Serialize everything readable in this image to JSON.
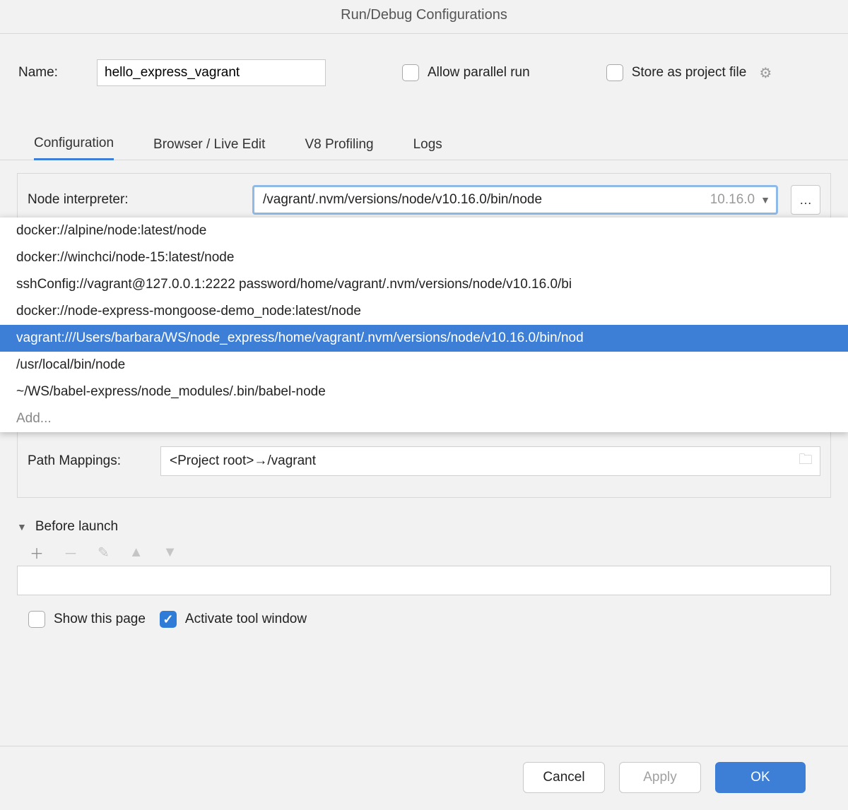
{
  "title": "Run/Debug Configurations",
  "name": {
    "label": "Name:",
    "value": "hello_express_vagrant"
  },
  "allow_parallel": {
    "label": "Allow parallel run",
    "checked": false
  },
  "store_project_file": {
    "label": "Store as project file",
    "checked": false
  },
  "tabs": [
    "Configuration",
    "Browser / Live Edit",
    "V8 Profiling",
    "Logs"
  ],
  "active_tab": 0,
  "node_interpreter": {
    "label": "Node interpreter:",
    "value": "/vagrant/.nvm/versions/node/v10.16.0/bin/node",
    "version": "10.16.0",
    "options": [
      "docker://alpine/node:latest/node",
      "docker://winchci/node-15:latest/node",
      "sshConfig://vagrant@127.0.0.1:2222 password/home/vagrant/.nvm/versions/node/v10.16.0/bi",
      "docker://node-express-mongoose-demo_node:latest/node",
      "vagrant:///Users/barbara/WS/node_express/home/vagrant/.nvm/versions/node/v10.16.0/bin/nod",
      "/usr/local/bin/node",
      "~/WS/babel-express/node_modules/.bin/babel-node"
    ],
    "add_label": "Add...",
    "selected_index": 4
  },
  "path_mappings": {
    "label": "Path Mappings:",
    "value": "<Project root>→/vagrant"
  },
  "before_launch": {
    "label": "Before launch"
  },
  "show_this_page": {
    "label": "Show this page",
    "checked": false
  },
  "activate_tool_window": {
    "label": "Activate tool window",
    "checked": true
  },
  "buttons": {
    "cancel": "Cancel",
    "apply": "Apply",
    "ok": "OK"
  }
}
